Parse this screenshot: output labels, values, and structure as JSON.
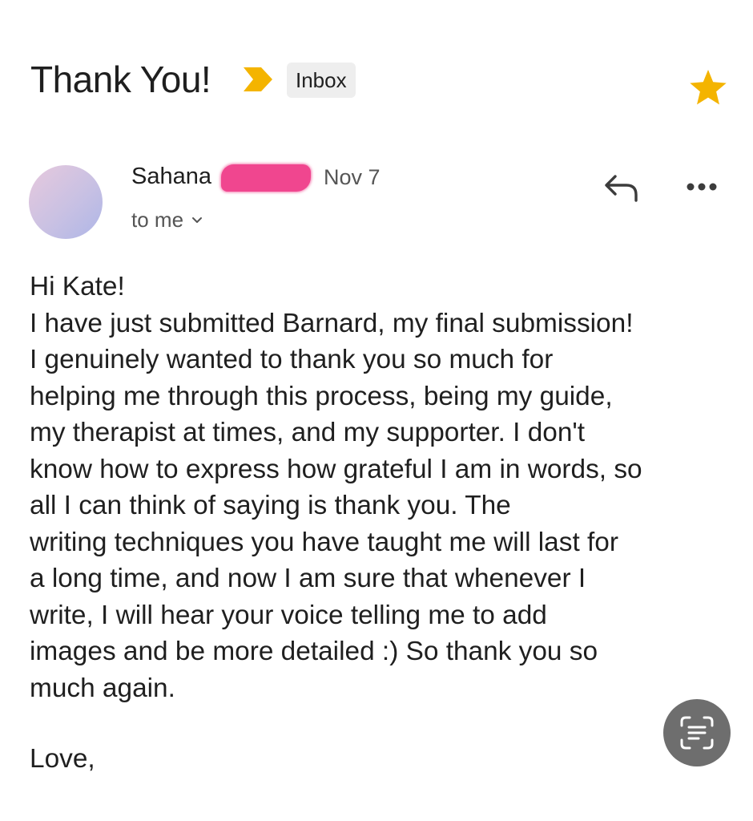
{
  "email": {
    "subject": "Thank You!",
    "label": "Inbox",
    "starred": true,
    "sender_name": "Sahana",
    "date": "Nov 7",
    "recipient": "to me",
    "body_lines": [
      "Hi Kate!",
      "I have just submitted Barnard, my final submission!",
      "I genuinely wanted to thank you so much for",
      "helping me through this process, being my guide,",
      "my therapist at times, and my supporter. I don't",
      "know how to express how grateful I am in words, so",
      "all I can think of saying is thank you. The",
      "writing techniques you have taught me will last for",
      "a long time, and now I am sure that whenever I",
      "write, I will hear your voice telling me to add",
      "images and be more detailed :) So thank you so",
      "much again."
    ],
    "signoff": "Love,"
  },
  "icons": {
    "importance": "important-marker-icon",
    "star": "star-icon",
    "recipient_toggle": "chevron-down-icon",
    "reply": "reply-icon",
    "more": "more-options-icon",
    "lens": "text-scan-icon"
  },
  "colors": {
    "importance": "#f4b400",
    "star": "#f4b400",
    "label_chip_bg": "#eeeeee",
    "redaction": "#f0468f",
    "lens_button_bg": "#6e6e6e"
  }
}
